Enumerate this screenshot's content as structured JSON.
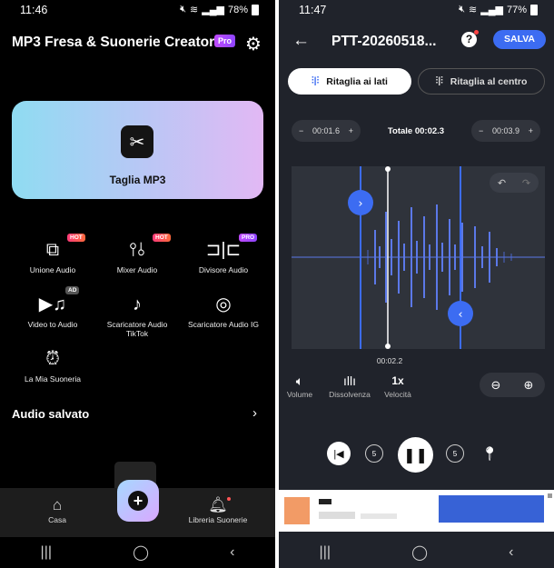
{
  "left": {
    "status": {
      "time": "11:46",
      "battery": "78%"
    },
    "title": "MP3 Fresa & Suonerie Creatore",
    "pro_badge": "Pro",
    "hero_label": "Taglia MP3",
    "tools": [
      {
        "label": "Unione Audio",
        "icon": "music-file-icon",
        "tag": "HOT"
      },
      {
        "label": "Mixer Audio",
        "icon": "sliders-icon",
        "tag": "HOT"
      },
      {
        "label": "Divisore Audio",
        "icon": "split-icon",
        "tag": "PRO"
      },
      {
        "label": "Video to Audio",
        "icon": "video-icon",
        "tag": "AD"
      },
      {
        "label": "Scaricatore Audio TikTok",
        "icon": "tiktok-icon",
        "tag": ""
      },
      {
        "label": "Scaricatore Audio IG",
        "icon": "instagram-icon",
        "tag": ""
      },
      {
        "label": "La Mia Suoneria",
        "icon": "alarm-icon",
        "tag": ""
      }
    ],
    "saved_title": "Audio salvato",
    "nav": {
      "home": "Casa",
      "library": "Libreria Suonerie"
    }
  },
  "right": {
    "status": {
      "time": "11:47",
      "battery": "77%"
    },
    "file_title": "PTT-20260518...",
    "help": "?",
    "save": "SALVA",
    "seg_active": "Ritaglia ai lati",
    "seg_inactive": "Ritaglia al centro",
    "start_time": "00:01.6",
    "total": "Totale 00:02.3",
    "end_time": "00:03.9",
    "playhead_time": "00:02.2",
    "controls": {
      "volume": "Volume",
      "fade": "Dissolvenza",
      "speed": "Velocità",
      "speed_value": "1x"
    }
  },
  "colors": {
    "accent_blue": "#3c6cf2",
    "wave_blue": "#5b78e8",
    "bg_dark": "#20232b"
  }
}
